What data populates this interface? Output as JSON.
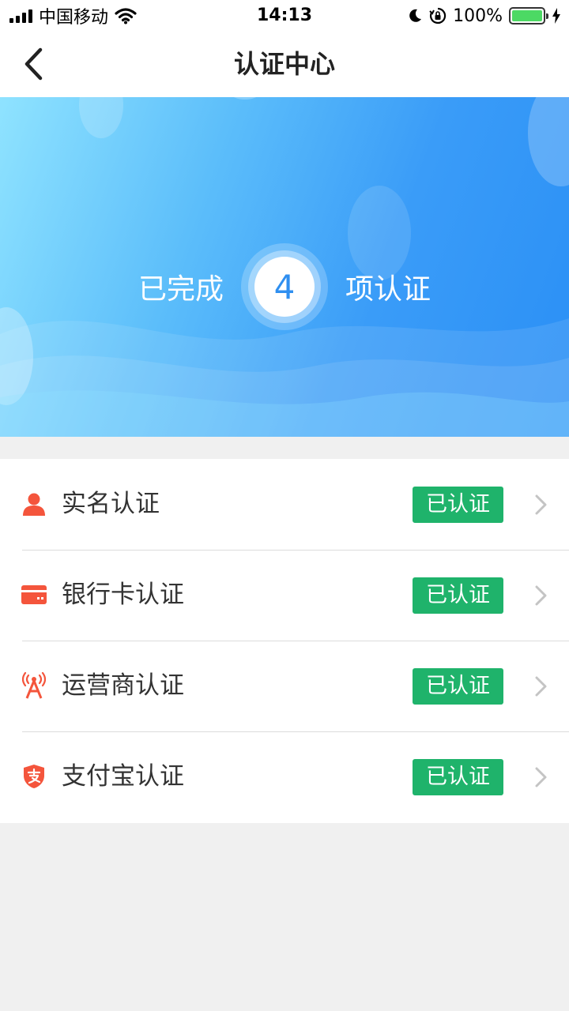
{
  "status_bar": {
    "carrier": "中国移动",
    "time": "14:13",
    "battery": "100%"
  },
  "nav": {
    "title": "认证中心"
  },
  "banner": {
    "prefix": "已完成",
    "count": "4",
    "suffix": "项认证"
  },
  "colors": {
    "accent_icon": "#f4553c",
    "badge_green": "#1fb36b",
    "banner_blue": "#3a9cf8"
  },
  "items": [
    {
      "icon": "user-icon",
      "label": "实名认证",
      "status": "已认证"
    },
    {
      "icon": "bank-card-icon",
      "label": "银行卡认证",
      "status": "已认证"
    },
    {
      "icon": "signal-tower-icon",
      "label": "运营商认证",
      "status": "已认证"
    },
    {
      "icon": "alipay-shield-icon",
      "label": "支付宝认证",
      "status": "已认证"
    }
  ]
}
